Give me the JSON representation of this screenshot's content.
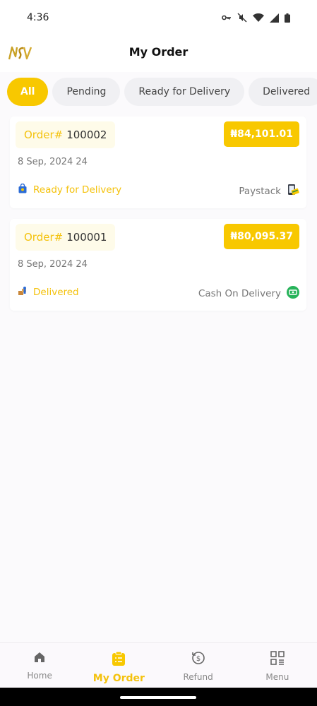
{
  "status_bar": {
    "time": "4:36",
    "icons": [
      "key-icon",
      "mute-icon",
      "wifi-icon",
      "signal-icon",
      "battery-icon"
    ]
  },
  "header": {
    "title": "My Order",
    "logo_text": "NSV"
  },
  "tabs": [
    {
      "label": "All",
      "active": true
    },
    {
      "label": "Pending",
      "active": false
    },
    {
      "label": "Ready for Delivery",
      "active": false
    },
    {
      "label": "Delivered",
      "active": false
    }
  ],
  "orders": [
    {
      "id_label": "Order#",
      "id": "100002",
      "price": "84,101.01",
      "date": "8 Sep, 2024 24",
      "status": "Ready for Delivery",
      "status_icon": "bag-icon",
      "payment": "Paystack",
      "payment_icon": "card-icon"
    },
    {
      "id_label": "Order#",
      "id": "100001",
      "price": "80,095.37",
      "date": "8 Sep, 2024 24",
      "status": "Delivered",
      "status_icon": "delivery-box-icon",
      "payment": "Cash On Delivery",
      "payment_icon": "cash-icon"
    }
  ],
  "bottom_nav": [
    {
      "label": "Home",
      "icon": "home-icon",
      "active": false
    },
    {
      "label": "My Order",
      "icon": "clipboard-icon",
      "active": true
    },
    {
      "label": "Refund",
      "icon": "refund-icon",
      "active": false
    },
    {
      "label": "Menu",
      "icon": "menu-grid-icon",
      "active": false
    }
  ],
  "colors": {
    "accent": "#f8c800",
    "accent_text": "#f4c20d",
    "background": "#fbfafc"
  }
}
